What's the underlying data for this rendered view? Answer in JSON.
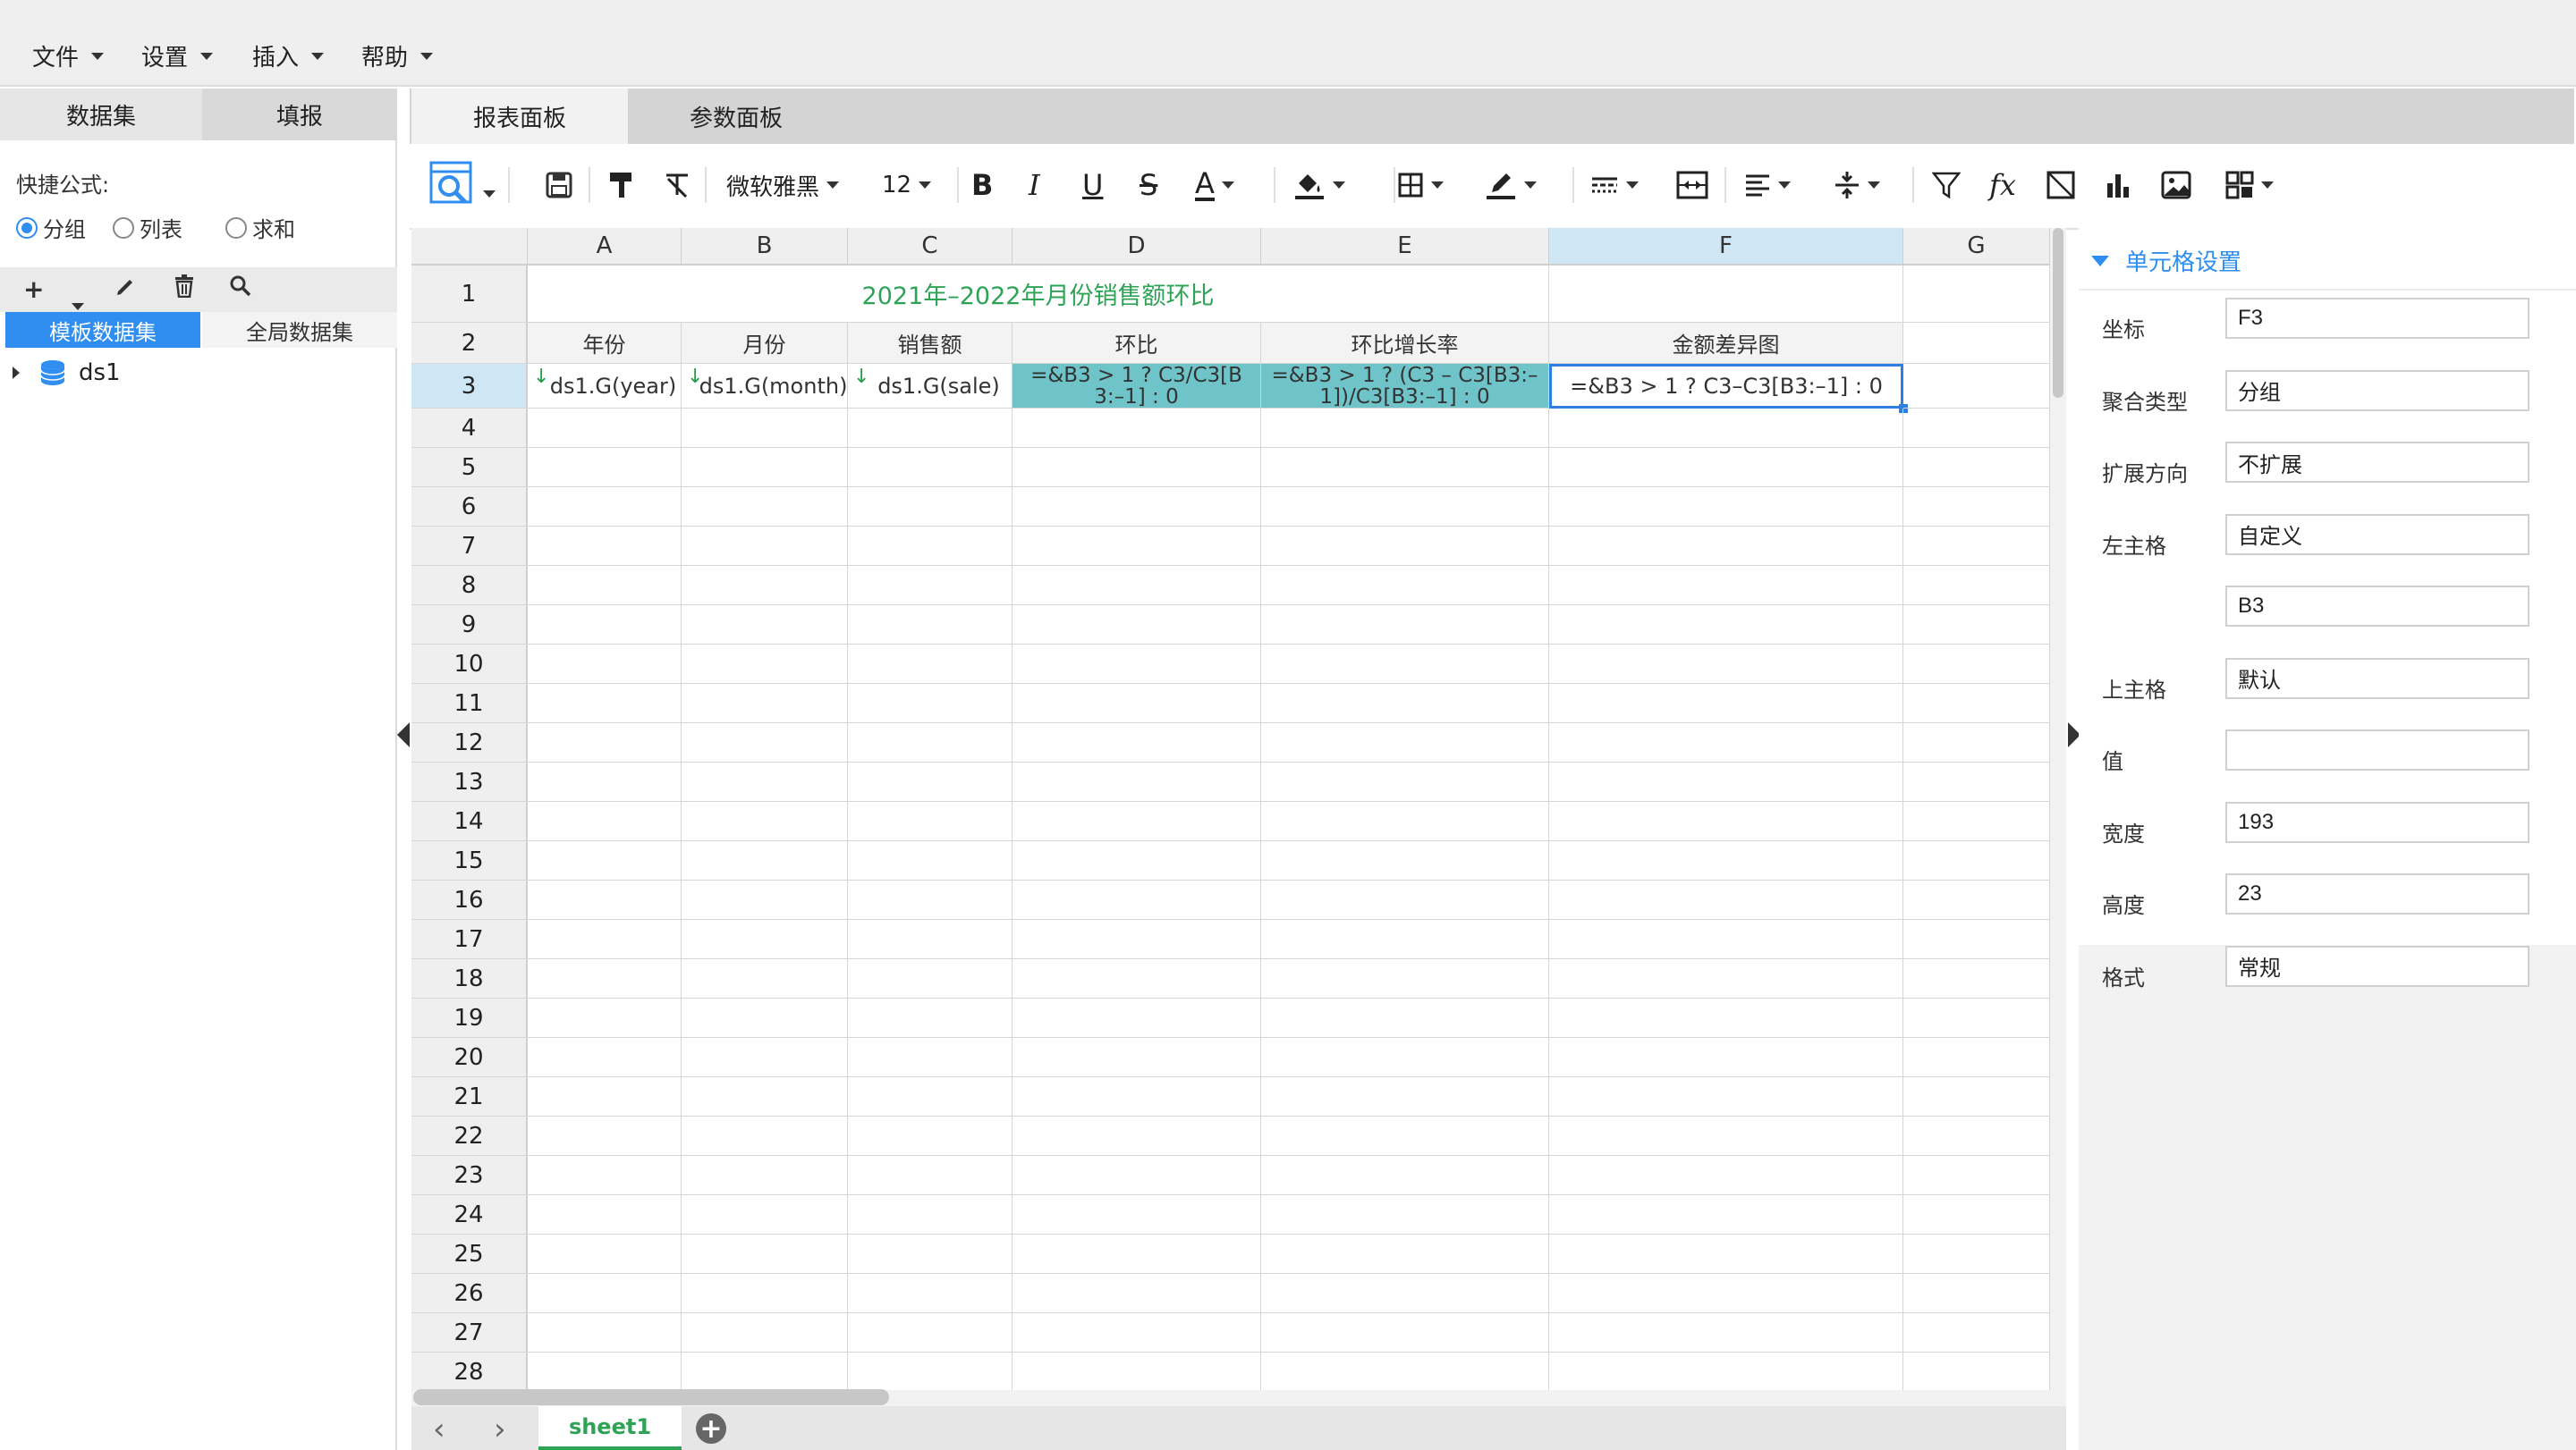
{
  "menu": [
    "文件",
    "设置",
    "插入",
    "帮助"
  ],
  "left": {
    "tabs": [
      "数据集",
      "填报"
    ],
    "quick_formula_label": "快捷公式:",
    "radios": [
      {
        "label": "分组",
        "checked": true
      },
      {
        "label": "列表",
        "checked": false
      },
      {
        "label": "求和",
        "checked": false
      }
    ],
    "dataset_tabs": [
      "模板数据集",
      "全局数据集"
    ],
    "tree": {
      "label": "ds1"
    }
  },
  "center": {
    "tabs": [
      "报表面板",
      "参数面板"
    ],
    "toolbar": {
      "font": "微软雅黑",
      "size": "12"
    }
  },
  "sheet": {
    "columns": [
      "A",
      "B",
      "C",
      "D",
      "E",
      "F",
      "G"
    ],
    "selected_column": "F",
    "selected_row": 3,
    "rows": [
      "1",
      "2",
      "3",
      "4",
      "5",
      "6",
      "7",
      "8",
      "9",
      "10",
      "11",
      "12",
      "13",
      "14",
      "15",
      "16",
      "17",
      "18",
      "19",
      "20",
      "21",
      "22",
      "23",
      "24",
      "25",
      "26",
      "27",
      "28"
    ],
    "title": "2021年–2022年月份销售额环比",
    "headers": [
      "年份",
      "月份",
      "销售额",
      "环比",
      "环比增长率",
      "金额差异图"
    ],
    "row3": {
      "a": "ds1.G(year)",
      "b": "ds1.G(month)",
      "c": "ds1.G(sale)",
      "d1": "=&B3 > 1 ? C3/C3[B",
      "d2": "3:–1] : 0",
      "e1": "=&B3 > 1 ? (C3 – C3[B3:–",
      "e2": "1])/C3[B3:–1] : 0",
      "f": "=&B3 > 1 ? C3–C3[B3:–1] : 0"
    },
    "sheet_tab": "sheet1"
  },
  "props": {
    "title": "单元格设置",
    "fields": [
      {
        "label": "坐标",
        "value": "F3"
      },
      {
        "label": "聚合类型",
        "value": "分组"
      },
      {
        "label": "扩展方向",
        "value": "不扩展"
      },
      {
        "label": "左主格",
        "value": "自定义"
      },
      {
        "label": "",
        "value": "B3"
      },
      {
        "label": "上主格",
        "value": "默认"
      },
      {
        "label": "值",
        "value": ""
      },
      {
        "label": "宽度",
        "value": "193"
      },
      {
        "label": "高度",
        "value": "23"
      },
      {
        "label": "格式",
        "value": "常规"
      }
    ]
  },
  "colors": {
    "accent": "#2f8ef0",
    "title_green": "#2ea356",
    "formula_fill": "#6ec4c8",
    "selection": "#2f7fe0"
  }
}
